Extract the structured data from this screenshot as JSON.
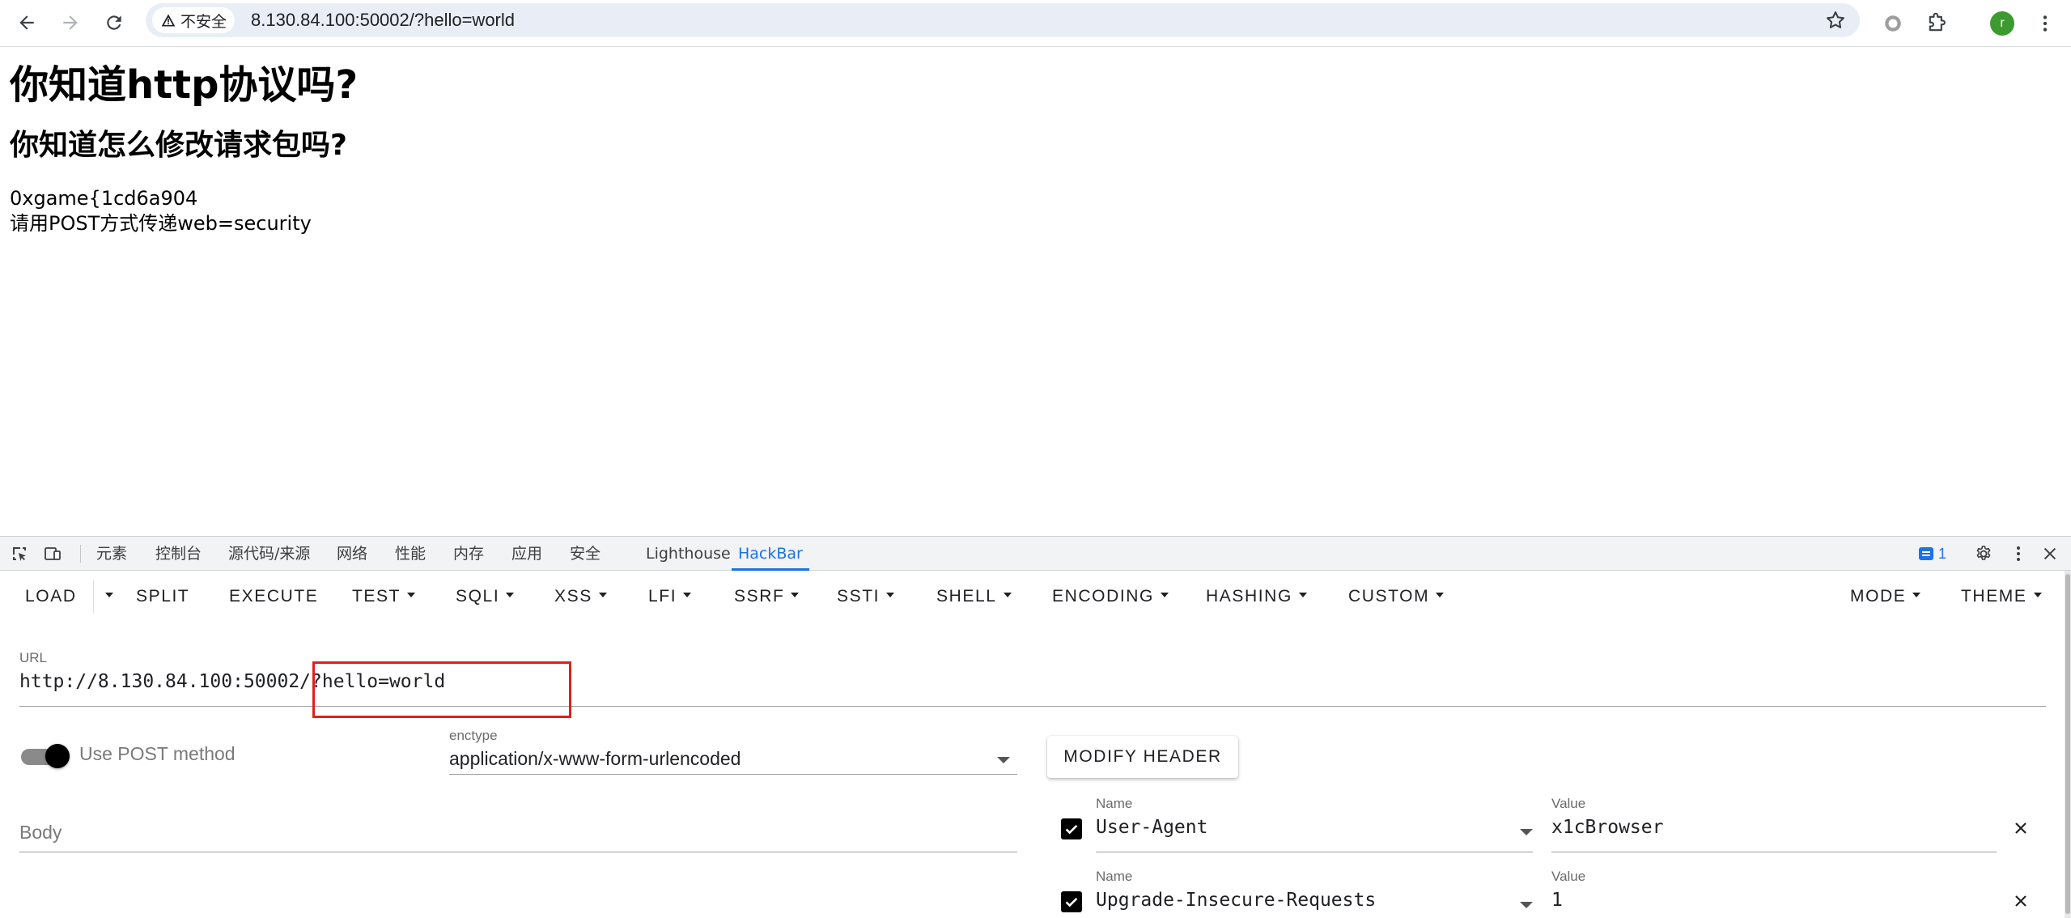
{
  "browser": {
    "security_label": "不安全",
    "url": "8.130.84.100:50002/?hello=world",
    "avatar_letter": "r"
  },
  "page": {
    "heading1": "你知道http协议吗?",
    "heading2": "你知道怎么修改请求包吗?",
    "line1": "0xgame{1cd6a904",
    "line2": "请用POST方式传递web=security"
  },
  "devtools": {
    "tabs": [
      "元素",
      "控制台",
      "源代码/来源",
      "网络",
      "性能",
      "内存",
      "应用",
      "安全",
      "Lighthouse",
      "HackBar"
    ],
    "active_tab": "HackBar",
    "issues_count": "1"
  },
  "hackbar": {
    "menu": [
      "LOAD",
      "SPLIT",
      "EXECUTE",
      "TEST",
      "SQLI",
      "XSS",
      "LFI",
      "SSRF",
      "SSTI",
      "SHELL",
      "ENCODING",
      "HASHING",
      "CUSTOM",
      "MODE",
      "THEME"
    ],
    "url_label": "URL",
    "url_value": "http://8.130.84.100:50002/?hello=world",
    "post_toggle_label": "Use POST method",
    "post_enabled": true,
    "enctype_label": "enctype",
    "enctype_value": "application/x-www-form-urlencoded",
    "modify_header_label": "MODIFY HEADER",
    "body_placeholder": "Body",
    "headers": [
      {
        "enabled": true,
        "name_label": "Name",
        "name": "User-Agent",
        "value_label": "Value",
        "value": "x1cBrowser"
      },
      {
        "enabled": true,
        "name_label": "Name",
        "name": "Upgrade-Insecure-Requests",
        "value_label": "Value",
        "value": "1"
      }
    ]
  },
  "colors": {
    "accent": "#1a73e8",
    "highlight": "#e0201b",
    "avatar": "#3c9a2e"
  }
}
